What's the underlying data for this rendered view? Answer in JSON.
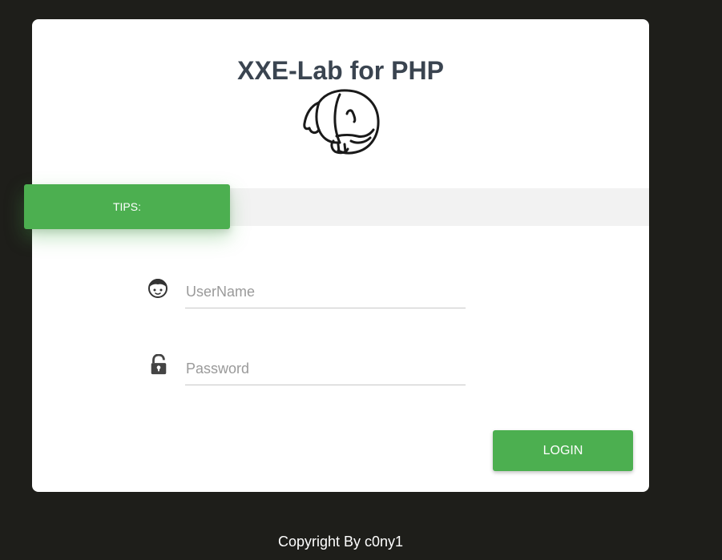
{
  "header": {
    "title": "XXE-Lab for PHP",
    "logo_icon": "php-elephant-icon"
  },
  "tips": {
    "label": "TIPS:"
  },
  "form": {
    "username": {
      "placeholder": "UserName",
      "value": "",
      "icon": "user-icon"
    },
    "password": {
      "placeholder": "Password",
      "value": "",
      "icon": "lock-icon"
    },
    "login_label": "LOGIN"
  },
  "footer": {
    "copyright": "Copyright By c0ny1"
  },
  "colors": {
    "background": "#1e1e1a",
    "card": "#ffffff",
    "accent": "#4caf50",
    "tips_bar": "#f2f2f2",
    "title": "#3a4450"
  }
}
